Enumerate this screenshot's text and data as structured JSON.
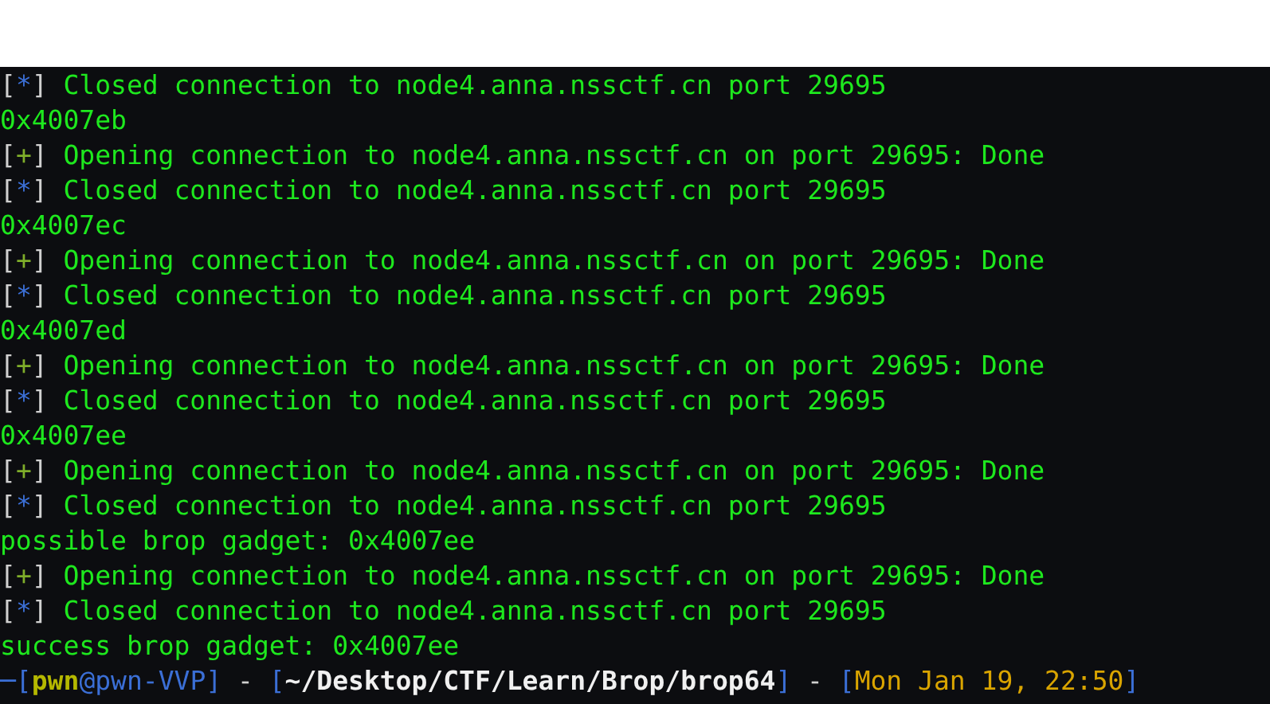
{
  "terminal": {
    "lines": [
      {
        "kind": "closed",
        "open": "[",
        "marker": "*",
        "close": "]",
        "text": "Closed connection to node4.anna.nssctf.cn port 29695"
      },
      {
        "kind": "plain",
        "text": "0x4007eb"
      },
      {
        "kind": "opening",
        "open": "[",
        "marker": "+",
        "close": "]",
        "text": "Opening connection to node4.anna.nssctf.cn on port 29695: Done"
      },
      {
        "kind": "closed",
        "open": "[",
        "marker": "*",
        "close": "]",
        "text": "Closed connection to node4.anna.nssctf.cn port 29695"
      },
      {
        "kind": "plain",
        "text": "0x4007ec"
      },
      {
        "kind": "opening",
        "open": "[",
        "marker": "+",
        "close": "]",
        "text": "Opening connection to node4.anna.nssctf.cn on port 29695: Done"
      },
      {
        "kind": "closed",
        "open": "[",
        "marker": "*",
        "close": "]",
        "text": "Closed connection to node4.anna.nssctf.cn port 29695"
      },
      {
        "kind": "plain",
        "text": "0x4007ed"
      },
      {
        "kind": "opening",
        "open": "[",
        "marker": "+",
        "close": "]",
        "text": "Opening connection to node4.anna.nssctf.cn on port 29695: Done"
      },
      {
        "kind": "closed",
        "open": "[",
        "marker": "*",
        "close": "]",
        "text": "Closed connection to node4.anna.nssctf.cn port 29695"
      },
      {
        "kind": "plain",
        "text": "0x4007ee"
      },
      {
        "kind": "opening",
        "open": "[",
        "marker": "+",
        "close": "]",
        "text": "Opening connection to node4.anna.nssctf.cn on port 29695: Done"
      },
      {
        "kind": "closed",
        "open": "[",
        "marker": "*",
        "close": "]",
        "text": "Closed connection to node4.anna.nssctf.cn port 29695"
      },
      {
        "kind": "plain",
        "text": "possible brop gadget: 0x4007ee"
      },
      {
        "kind": "opening",
        "open": "[",
        "marker": "+",
        "close": "]",
        "text": "Opening connection to node4.anna.nssctf.cn on port 29695: Done"
      },
      {
        "kind": "closed",
        "open": "[",
        "marker": "*",
        "close": "]",
        "text": "Closed connection to node4.anna.nssctf.cn port 29695"
      },
      {
        "kind": "plain",
        "text": "success brop gadget: 0x4007ee"
      }
    ],
    "prompt": [
      {
        "kind": "bracket",
        "text": "─["
      },
      {
        "kind": "user",
        "text": "pwn"
      },
      {
        "kind": "host",
        "text": "@pwn-VVP"
      },
      {
        "kind": "bracket",
        "text": "]"
      },
      {
        "kind": "separator",
        "text": "-"
      },
      {
        "kind": "bracket",
        "text": "["
      },
      {
        "kind": "path",
        "text": "~/Desktop/CTF/Learn/Brop/brop64"
      },
      {
        "kind": "bracket",
        "text": "]"
      },
      {
        "kind": "separator",
        "text": "-"
      },
      {
        "kind": "bracket",
        "text": "["
      },
      {
        "kind": "datetime",
        "text": "Mon Jan 19, 22:50"
      },
      {
        "kind": "bracket",
        "text": "]"
      }
    ]
  }
}
